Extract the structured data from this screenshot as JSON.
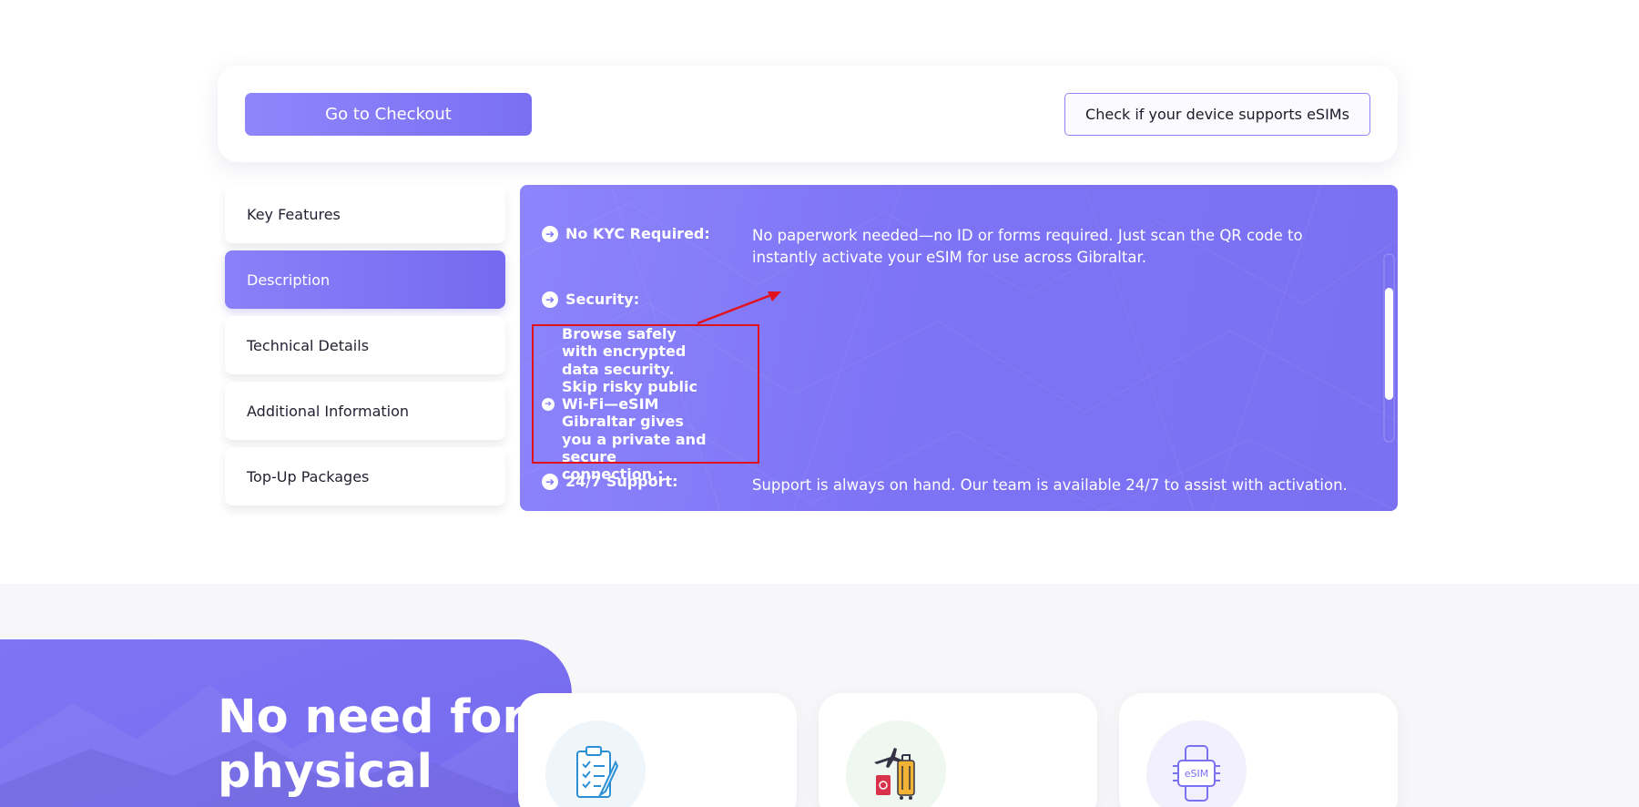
{
  "actions": {
    "checkout_label": "Go to Checkout",
    "device_check_label": "Check if your device supports eSIMs"
  },
  "tabs": [
    {
      "label": "Key Features",
      "active": false
    },
    {
      "label": "Description",
      "active": true
    },
    {
      "label": "Technical Details",
      "active": false
    },
    {
      "label": "Additional Information",
      "active": false
    },
    {
      "label": "Top-Up Packages",
      "active": false
    }
  ],
  "description": {
    "features": [
      {
        "label": "No KYC Required:",
        "text": "No paperwork needed—no ID or forms required. Just scan the QR code to instantly activate your eSIM for use across Gibraltar."
      },
      {
        "label": "Security:",
        "text": ""
      },
      {
        "label": "Browse safely with encrypted data security. Skip risky public Wi-Fi—eSIM Gibraltar gives you a private and secure connection.:",
        "text": ""
      },
      {
        "label": "24/7 Support:",
        "text": "Support is always on hand. Our team is available 24/7 to assist with activation."
      }
    ]
  },
  "hero": {
    "title_line1": "No need for",
    "title_line2": "physical"
  },
  "icons": {
    "card1": "clipboard-checklist-icon",
    "card2": "travel-luggage-icon",
    "card3": "esim-chip-icon"
  },
  "colors": {
    "accent": "#7b71f3",
    "highlight": "#e0121b"
  }
}
